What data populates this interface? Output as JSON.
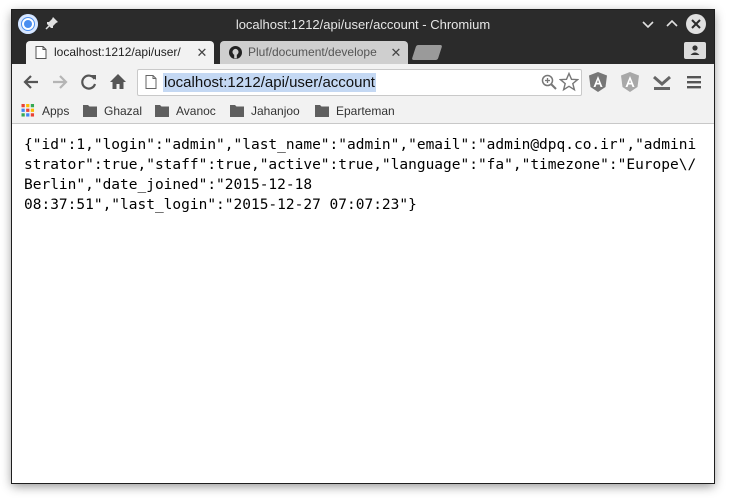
{
  "window": {
    "title": "localhost:1212/api/user/account - Chromium"
  },
  "tabs": [
    {
      "label": "localhost:1212/api/user/",
      "active": true,
      "icon": "page-icon"
    },
    {
      "label": "Pluf/document/develope",
      "active": false,
      "icon": "github-icon"
    }
  ],
  "toolbar": {
    "url": "localhost:1212/api/user/account"
  },
  "bookmarks": [
    {
      "label": "Apps",
      "icon": "apps-grid-icon"
    },
    {
      "label": "Ghazal",
      "icon": "folder-icon"
    },
    {
      "label": "Avanoc",
      "icon": "folder-icon"
    },
    {
      "label": "Jahanjoo",
      "icon": "folder-icon"
    },
    {
      "label": "Eparteman",
      "icon": "folder-icon"
    }
  ],
  "page": {
    "json_text": "{\"id\":1,\"login\":\"admin\",\"last_name\":\"admin\",\"email\":\"admin@dpq.co.ir\",\"administrator\":true,\"staff\":true,\"active\":true,\"language\":\"fa\",\"timezone\":\"Europe\\/Berlin\",\"date_joined\":\"2015-12-18\n08:37:51\",\"last_login\":\"2015-12-27 07:07:23\"}"
  },
  "colors": {
    "titlebar": "#2b2b2b",
    "toolbar": "#f2f2f2",
    "url_selection": "#c4d8f3"
  }
}
